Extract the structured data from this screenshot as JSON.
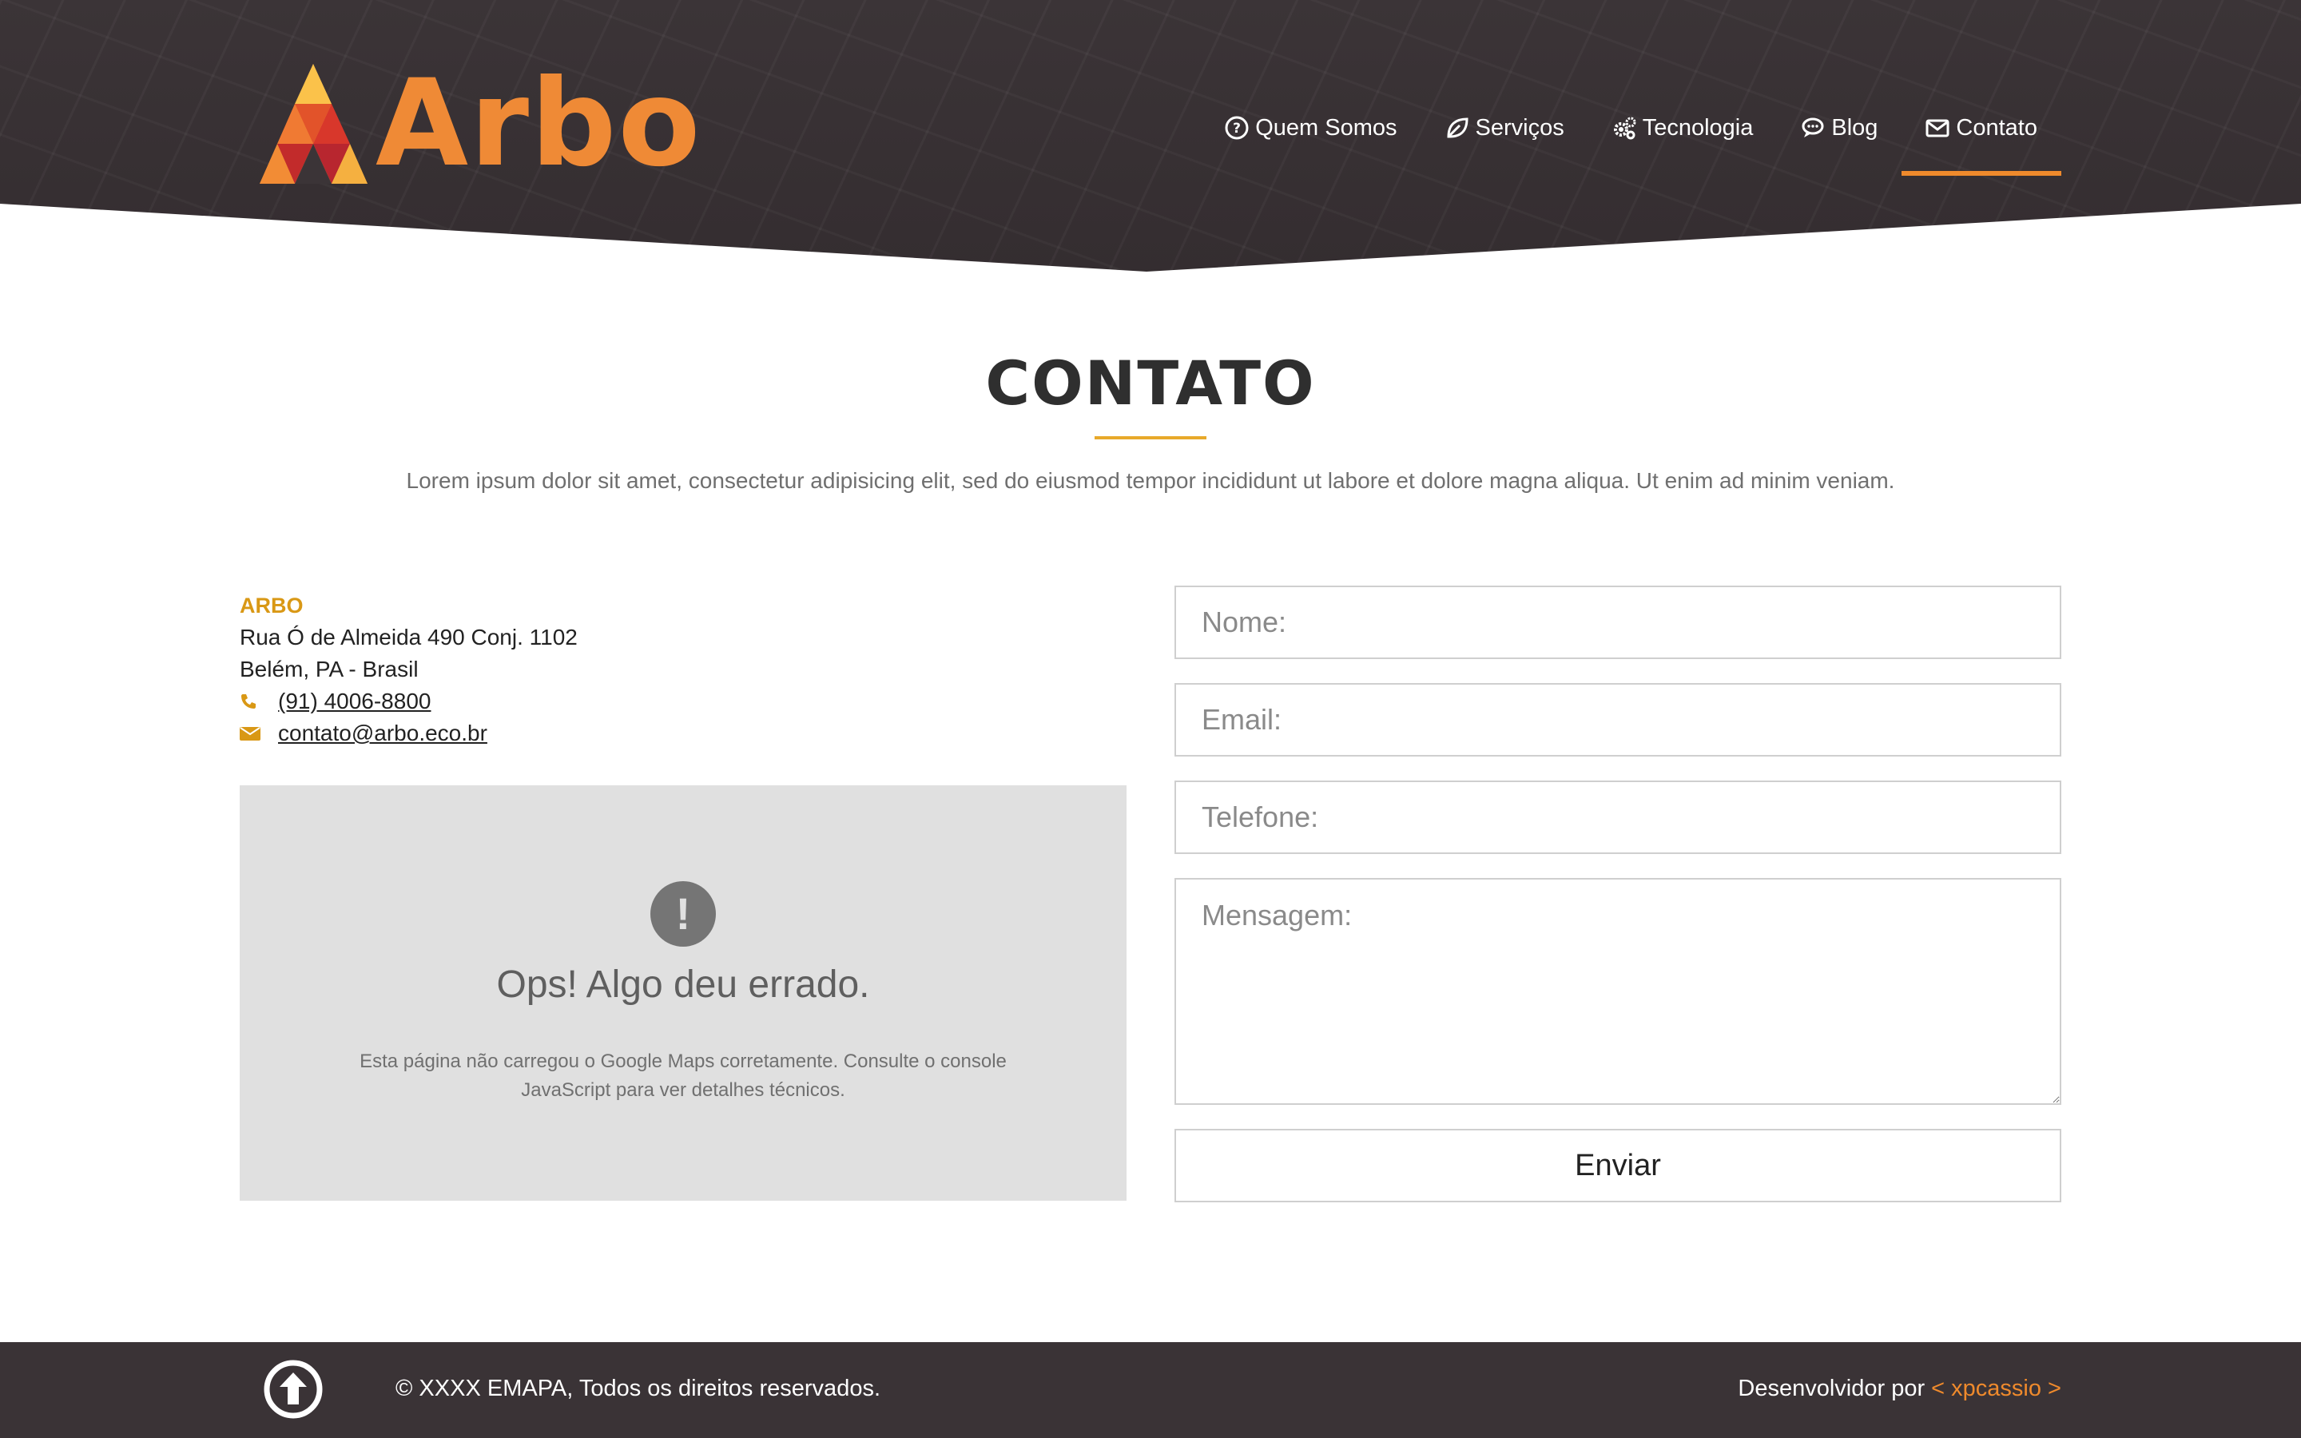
{
  "header": {
    "logo_text": "Arbo",
    "nav": [
      {
        "label": "Quem Somos",
        "icon": "question-circle-icon"
      },
      {
        "label": "Serviços",
        "icon": "leaf-icon"
      },
      {
        "label": "Tecnologia",
        "icon": "gears-icon"
      },
      {
        "label": "Blog",
        "icon": "comment-icon"
      },
      {
        "label": "Contato",
        "icon": "envelope-icon",
        "active": true
      }
    ]
  },
  "section": {
    "title": "CONTATO",
    "subtitle": "Lorem ipsum dolor sit amet, consectetur adipisicing elit, sed do eiusmod tempor incididunt ut labore et dolore magna aliqua. Ut enim ad minim veniam."
  },
  "contact": {
    "company": "ARBO",
    "address_line1": "Rua Ó de Almeida 490 Conj. 1102",
    "address_line2": "Belém, PA - Brasil",
    "phone": "(91) 4006-8800",
    "email": "contato@arbo.eco.br"
  },
  "map_error": {
    "icon_glyph": "!",
    "title": "Ops! Algo deu errado.",
    "message": "Esta página não carregou o Google Maps corretamente. Consulte o console JavaScript para ver detalhes técnicos."
  },
  "form": {
    "name_placeholder": "Nome:",
    "email_placeholder": "Email:",
    "phone_placeholder": "Telefone:",
    "message_placeholder": "Mensagem:",
    "submit_label": "Enviar"
  },
  "footer": {
    "copyright": "© XXXX EMAPA, Todos os direitos reservados.",
    "dev_prefix": "Desenvolvidor por ",
    "dev_name": "< xpcassio >"
  },
  "colors": {
    "brand_orange": "#ef8a36",
    "accent_gold": "#d99815",
    "header_bg": "#3b3437",
    "footer_bg": "#3a3336"
  }
}
